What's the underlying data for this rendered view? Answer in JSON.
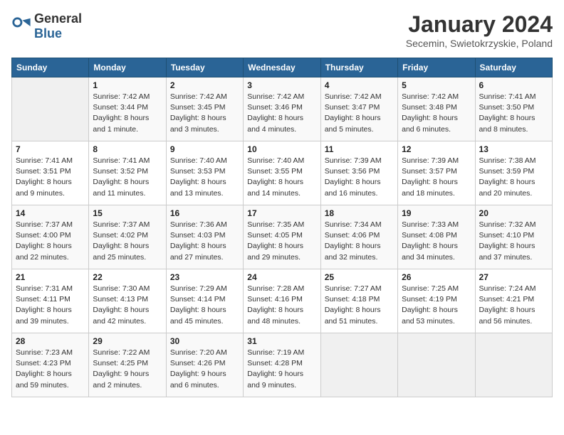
{
  "header": {
    "logo_general": "General",
    "logo_blue": "Blue",
    "title": "January 2024",
    "subtitle": "Secemin, Swietokrzyskie, Poland"
  },
  "weekdays": [
    "Sunday",
    "Monday",
    "Tuesday",
    "Wednesday",
    "Thursday",
    "Friday",
    "Saturday"
  ],
  "weeks": [
    [
      {
        "day": "",
        "info": ""
      },
      {
        "day": "1",
        "info": "Sunrise: 7:42 AM\nSunset: 3:44 PM\nDaylight: 8 hours\nand 1 minute."
      },
      {
        "day": "2",
        "info": "Sunrise: 7:42 AM\nSunset: 3:45 PM\nDaylight: 8 hours\nand 3 minutes."
      },
      {
        "day": "3",
        "info": "Sunrise: 7:42 AM\nSunset: 3:46 PM\nDaylight: 8 hours\nand 4 minutes."
      },
      {
        "day": "4",
        "info": "Sunrise: 7:42 AM\nSunset: 3:47 PM\nDaylight: 8 hours\nand 5 minutes."
      },
      {
        "day": "5",
        "info": "Sunrise: 7:42 AM\nSunset: 3:48 PM\nDaylight: 8 hours\nand 6 minutes."
      },
      {
        "day": "6",
        "info": "Sunrise: 7:41 AM\nSunset: 3:50 PM\nDaylight: 8 hours\nand 8 minutes."
      }
    ],
    [
      {
        "day": "7",
        "info": "Sunrise: 7:41 AM\nSunset: 3:51 PM\nDaylight: 8 hours\nand 9 minutes."
      },
      {
        "day": "8",
        "info": "Sunrise: 7:41 AM\nSunset: 3:52 PM\nDaylight: 8 hours\nand 11 minutes."
      },
      {
        "day": "9",
        "info": "Sunrise: 7:40 AM\nSunset: 3:53 PM\nDaylight: 8 hours\nand 13 minutes."
      },
      {
        "day": "10",
        "info": "Sunrise: 7:40 AM\nSunset: 3:55 PM\nDaylight: 8 hours\nand 14 minutes."
      },
      {
        "day": "11",
        "info": "Sunrise: 7:39 AM\nSunset: 3:56 PM\nDaylight: 8 hours\nand 16 minutes."
      },
      {
        "day": "12",
        "info": "Sunrise: 7:39 AM\nSunset: 3:57 PM\nDaylight: 8 hours\nand 18 minutes."
      },
      {
        "day": "13",
        "info": "Sunrise: 7:38 AM\nSunset: 3:59 PM\nDaylight: 8 hours\nand 20 minutes."
      }
    ],
    [
      {
        "day": "14",
        "info": "Sunrise: 7:37 AM\nSunset: 4:00 PM\nDaylight: 8 hours\nand 22 minutes."
      },
      {
        "day": "15",
        "info": "Sunrise: 7:37 AM\nSunset: 4:02 PM\nDaylight: 8 hours\nand 25 minutes."
      },
      {
        "day": "16",
        "info": "Sunrise: 7:36 AM\nSunset: 4:03 PM\nDaylight: 8 hours\nand 27 minutes."
      },
      {
        "day": "17",
        "info": "Sunrise: 7:35 AM\nSunset: 4:05 PM\nDaylight: 8 hours\nand 29 minutes."
      },
      {
        "day": "18",
        "info": "Sunrise: 7:34 AM\nSunset: 4:06 PM\nDaylight: 8 hours\nand 32 minutes."
      },
      {
        "day": "19",
        "info": "Sunrise: 7:33 AM\nSunset: 4:08 PM\nDaylight: 8 hours\nand 34 minutes."
      },
      {
        "day": "20",
        "info": "Sunrise: 7:32 AM\nSunset: 4:10 PM\nDaylight: 8 hours\nand 37 minutes."
      }
    ],
    [
      {
        "day": "21",
        "info": "Sunrise: 7:31 AM\nSunset: 4:11 PM\nDaylight: 8 hours\nand 39 minutes."
      },
      {
        "day": "22",
        "info": "Sunrise: 7:30 AM\nSunset: 4:13 PM\nDaylight: 8 hours\nand 42 minutes."
      },
      {
        "day": "23",
        "info": "Sunrise: 7:29 AM\nSunset: 4:14 PM\nDaylight: 8 hours\nand 45 minutes."
      },
      {
        "day": "24",
        "info": "Sunrise: 7:28 AM\nSunset: 4:16 PM\nDaylight: 8 hours\nand 48 minutes."
      },
      {
        "day": "25",
        "info": "Sunrise: 7:27 AM\nSunset: 4:18 PM\nDaylight: 8 hours\nand 51 minutes."
      },
      {
        "day": "26",
        "info": "Sunrise: 7:25 AM\nSunset: 4:19 PM\nDaylight: 8 hours\nand 53 minutes."
      },
      {
        "day": "27",
        "info": "Sunrise: 7:24 AM\nSunset: 4:21 PM\nDaylight: 8 hours\nand 56 minutes."
      }
    ],
    [
      {
        "day": "28",
        "info": "Sunrise: 7:23 AM\nSunset: 4:23 PM\nDaylight: 8 hours\nand 59 minutes."
      },
      {
        "day": "29",
        "info": "Sunrise: 7:22 AM\nSunset: 4:25 PM\nDaylight: 9 hours\nand 2 minutes."
      },
      {
        "day": "30",
        "info": "Sunrise: 7:20 AM\nSunset: 4:26 PM\nDaylight: 9 hours\nand 6 minutes."
      },
      {
        "day": "31",
        "info": "Sunrise: 7:19 AM\nSunset: 4:28 PM\nDaylight: 9 hours\nand 9 minutes."
      },
      {
        "day": "",
        "info": ""
      },
      {
        "day": "",
        "info": ""
      },
      {
        "day": "",
        "info": ""
      }
    ]
  ]
}
